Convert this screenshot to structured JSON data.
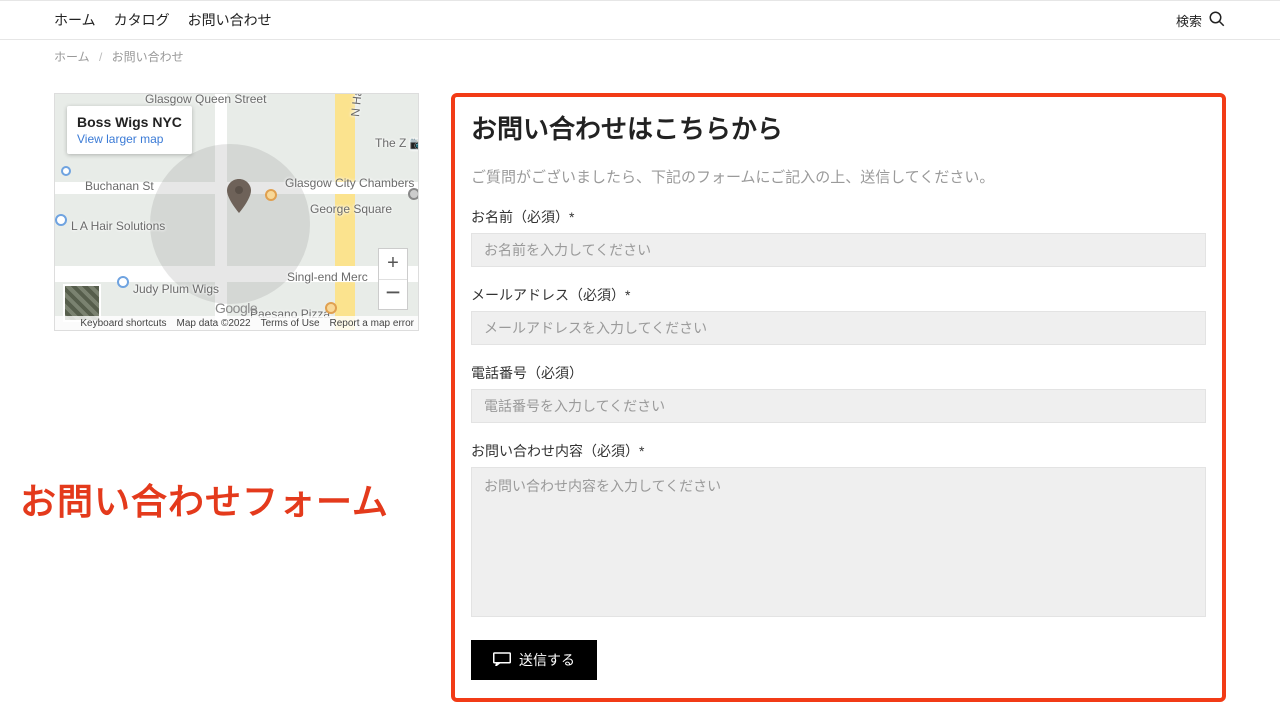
{
  "nav": {
    "home": "ホーム",
    "catalog": "カタログ",
    "contact": "お問い合わせ",
    "search": "検索"
  },
  "breadcrumb": {
    "home": "ホーム",
    "current": "お問い合わせ"
  },
  "map": {
    "info_title": "Boss Wigs NYC",
    "info_link": "View larger map",
    "labels": {
      "queen": "Glasgow Queen Street",
      "hanover": "N Hanov",
      "thez": "The Z",
      "buchanan": "Buchanan St",
      "chambers": "Glasgow City Chambers",
      "gsquare": "George Square",
      "lahair": "L A Hair Solutions",
      "judy": "Judy Plum Wigs",
      "singl": "Singl-end Merc",
      "paesano": "Paesano Pizza"
    },
    "footer": {
      "shortcuts": "Keyboard shortcuts",
      "data": "Map data ©2022",
      "terms": "Terms of Use",
      "report": "Report a map error"
    },
    "google": "Google"
  },
  "annotation": "お問い合わせフォーム",
  "form": {
    "title": "お問い合わせはこちらから",
    "intro": "ご質問がございましたら、下記のフォームにご記入の上、送信してください。",
    "name_label": "お名前（必須）*",
    "name_ph": "お名前を入力してください",
    "email_label": "メールアドレス（必須）*",
    "email_ph": "メールアドレスを入力してください",
    "phone_label": "電話番号（必須）",
    "phone_ph": "電話番号を入力してください",
    "body_label": "お問い合わせ内容（必須）*",
    "body_ph": "お問い合わせ内容を入力してください",
    "submit": "送信する"
  }
}
